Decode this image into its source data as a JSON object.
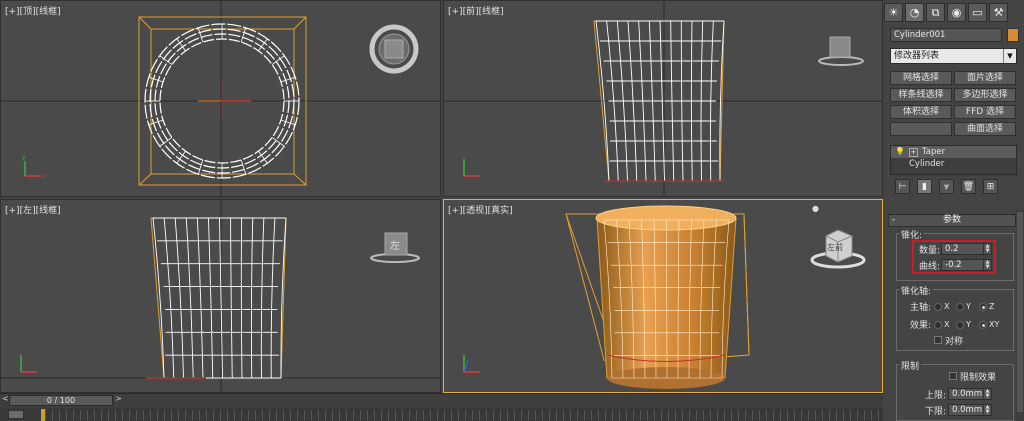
{
  "viewports": {
    "top": {
      "label": "[+][顶][线框]"
    },
    "front": {
      "label": "[+][前][线框]"
    },
    "left": {
      "label": "[+][左][线框]",
      "cube_face": "左"
    },
    "perspective": {
      "label": "[+][透视][真实]",
      "cube_face": "左前"
    }
  },
  "command_panel": {
    "tab_icons": [
      "sun-icon",
      "curve-icon",
      "hierarchy-icon",
      "motion-icon",
      "display-icon",
      "hammer-icon"
    ],
    "object_name": "Cylinder001",
    "object_color": "#d78c30",
    "modifier_list": "修改器列表",
    "modifier_buttons": [
      [
        "网格选择",
        "面片选择"
      ],
      [
        "样条线选择",
        "多边形选择"
      ],
      [
        "体积选择",
        "FFD 选择"
      ],
      [
        "",
        "曲面选择"
      ]
    ],
    "stack": [
      {
        "name": "Taper",
        "expand": "+",
        "selected": true
      },
      {
        "name": "Cylinder",
        "selected": false
      }
    ],
    "params": {
      "header": "参数",
      "taper_group": "锥化:",
      "amount_label": "数量:",
      "amount_value": "0.2",
      "curve_label": "曲线:",
      "curve_value": "-0.2",
      "axis_group": "锥化轴:",
      "primary_label": "主轴:",
      "primary_options": [
        "X",
        "Y",
        "Z"
      ],
      "primary_selected": "Z",
      "effect_label": "效果:",
      "effect_options": [
        "X",
        "Y",
        "XY"
      ],
      "effect_selected": "XY",
      "symmetry_label": "对称",
      "limit_group": "限制",
      "limit_effect_label": "限制效果",
      "upper_label": "上限:",
      "upper_value": "0.0mm",
      "lower_label": "下限:",
      "lower_value": "0.0mm"
    }
  },
  "timeline": {
    "frame": "0 / 100",
    "prev": "<",
    "next": ">"
  }
}
